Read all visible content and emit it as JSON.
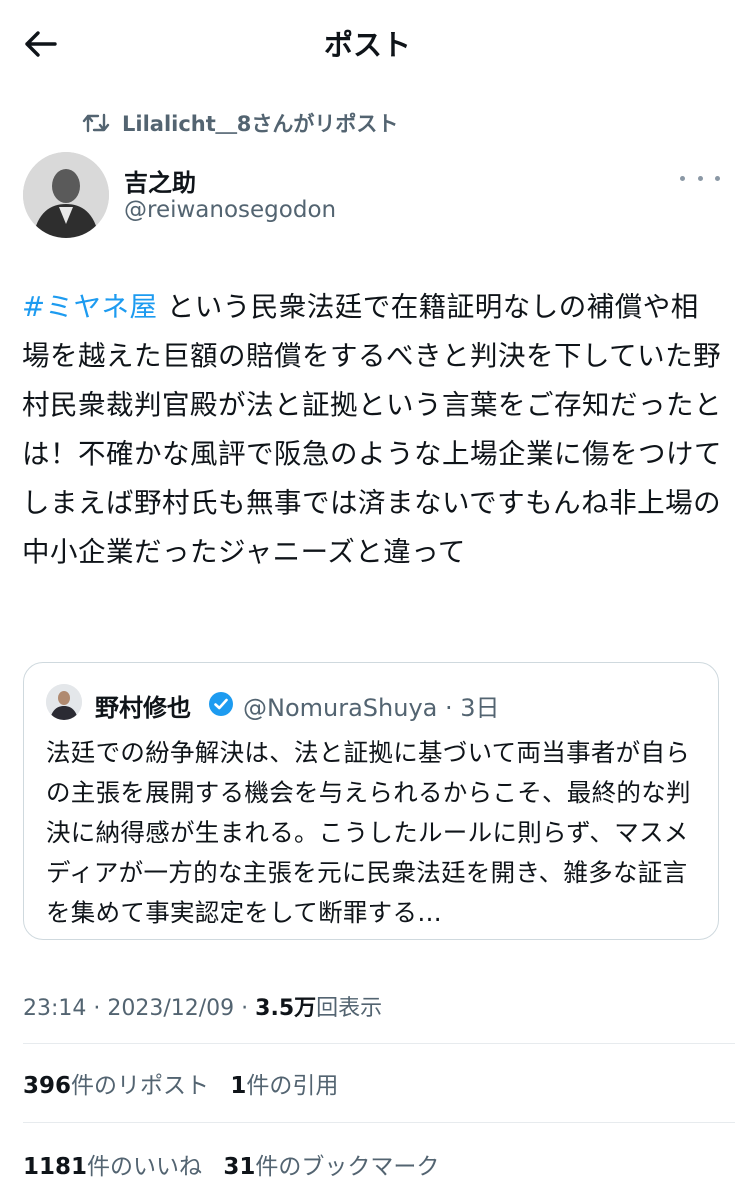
{
  "header": {
    "title": "ポスト"
  },
  "repost": {
    "text": "Lilalicht＿8さんがリポスト"
  },
  "author": {
    "name": "吉之助",
    "handle": "@reiwanosegodon"
  },
  "post": {
    "hashtag": "#ミヤネ屋",
    "text": " という民衆法廷で在籍証明なしの補償や相場を越えた巨額の賠償をするべきと判決を下していた野村民衆裁判官殿が法と証拠という言葉をご存知だったとは！不確かな風評で阪急のような上場企業に傷をつけてしまえば野村氏も無事では済まないですもんね非上場の中小企業だったジャニーズと違って"
  },
  "quote": {
    "name": "野村修也",
    "handle": "@NomuraShuya · 3日",
    "text": "法廷での紛争解決は、法と証拠に基づいて両当事者が自らの主張を展開する機会を与えられるからこそ、最終的な判決に納得感が生まれる。こうしたルールに則らず、マスメディアが一方的な主張を元に民衆法廷を開き、雑多な証言を集めて事実認定をして断罪する…"
  },
  "meta": {
    "time": "23:14 · 2023/12/09 · ",
    "views": "3.5万",
    "views_label": "回表示"
  },
  "stats": {
    "reposts": "396",
    "reposts_label": "件のリポスト",
    "quotes": "1",
    "quotes_label": "件の引用",
    "likes": "1181",
    "likes_label": "件のいいね",
    "bookmarks": "31",
    "bookmarks_label": "件のブックマーク"
  },
  "colors": {
    "link": "#1d9bf0",
    "secondary": "#536471",
    "text": "#0f1419",
    "border": "#cfd9de"
  }
}
